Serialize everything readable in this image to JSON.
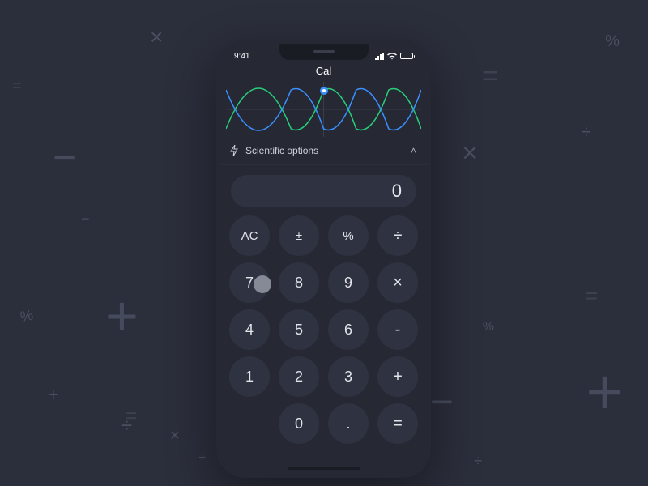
{
  "status": {
    "time": "9:41"
  },
  "app": {
    "title": "Cal"
  },
  "scientific": {
    "label": "Scientific options"
  },
  "display": {
    "value": "0"
  },
  "keys": {
    "ac": "AC",
    "pm": "±",
    "pct": "%",
    "div": "÷",
    "k7": "7",
    "k8": "8",
    "k9": "9",
    "mul": "×",
    "k4": "4",
    "k5": "5",
    "k6": "6",
    "sub": "-",
    "k1": "1",
    "k2": "2",
    "k3": "3",
    "add": "+",
    "k0": "0",
    "dot": ".",
    "eq": "="
  }
}
